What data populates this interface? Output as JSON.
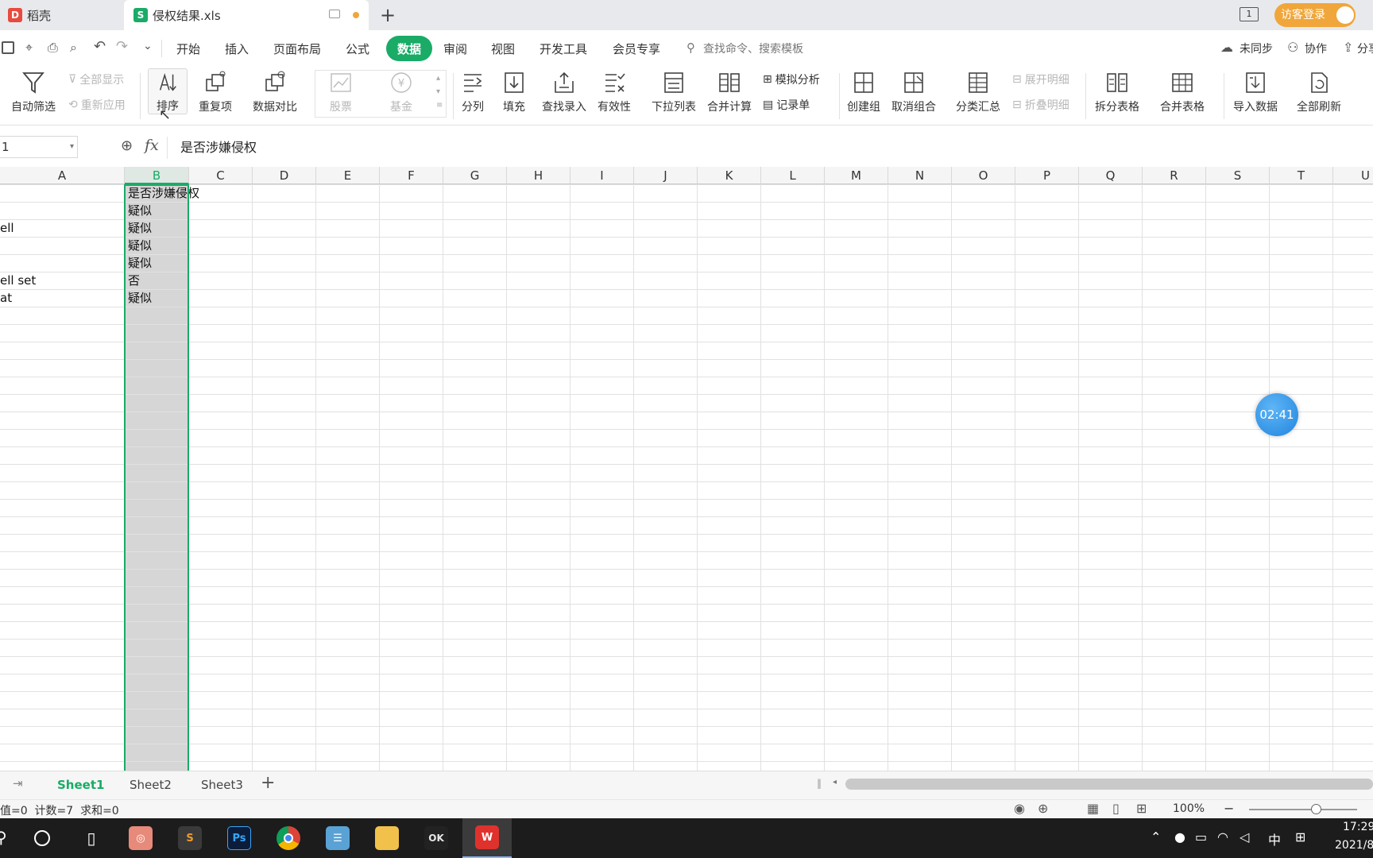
{
  "titlebar": {
    "tabs": [
      {
        "label": "稻壳",
        "icon": "docer-icon"
      },
      {
        "label": "侵权结果.xls",
        "icon": "spreadsheet-icon"
      }
    ],
    "page_num": "1",
    "login_label": "访客登录"
  },
  "menubar": {
    "items": [
      "开始",
      "插入",
      "页面布局",
      "公式",
      "数据",
      "审阅",
      "视图",
      "开发工具",
      "会员专享"
    ],
    "active": "数据",
    "search_placeholder": "查找命令、搜索模板",
    "sync_label": "未同步",
    "collab_label": "协作",
    "share_label": "分享"
  },
  "ribbon": {
    "autofilter": "自动筛选",
    "show_all": "全部显示",
    "reapply": "重新应用",
    "sort": "排序",
    "duplicates": "重复项",
    "compare": "数据对比",
    "stock": "股票",
    "fund": "基金",
    "split_col": "分列",
    "fill": "填充",
    "lookup": "查找录入",
    "validity": "有效性",
    "dropdown": "下拉列表",
    "consolidate": "合并计算",
    "what_if": "模拟分析",
    "record": "记录单",
    "create_group": "创建组",
    "ungroup": "取消组合",
    "subtotal": "分类汇总",
    "expand": "展开明细",
    "collapse": "折叠明细",
    "split_table": "拆分表格",
    "merge_table": "合并表格",
    "import": "导入数据",
    "refresh_all": "全部刷新"
  },
  "formulabar": {
    "name_box": "1",
    "formula": "是否涉嫌侵权"
  },
  "grid": {
    "columns": [
      "A",
      "B",
      "C",
      "D",
      "E",
      "F",
      "G",
      "H",
      "I",
      "J",
      "K",
      "L",
      "M",
      "N",
      "O",
      "P",
      "Q",
      "R",
      "S",
      "T",
      "U"
    ],
    "selected_column": "B",
    "col_a": [
      "",
      "",
      "ell",
      "",
      "",
      "ell set",
      "at"
    ],
    "col_b": [
      "是否涉嫌侵权",
      "疑似",
      "疑似",
      "疑似",
      "疑似",
      "否",
      "疑似"
    ]
  },
  "timer": "02:41",
  "sheets": {
    "tabs": [
      "Sheet1",
      "Sheet2",
      "Sheet3"
    ],
    "active": "Sheet1"
  },
  "status": {
    "summary": "值=0  计数=7  求和=0",
    "zoom": "100%"
  },
  "taskbar": {
    "ime": "中",
    "time": "17:29",
    "date": "2021/8"
  },
  "colors": {
    "accent": "#1aab67",
    "selected_col": "#d6d6d6",
    "login_badge": "#f0a63a"
  }
}
